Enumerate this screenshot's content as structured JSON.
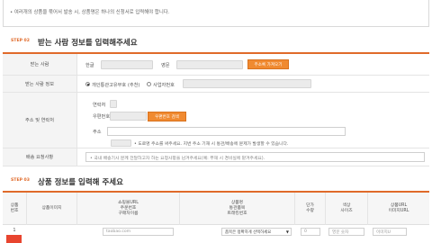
{
  "notice": {
    "text": "• 여러개의 상품을 묶어서 발송 시, 상품명은 하나의 신청서로 입력해야 합니다.",
    "highlight": ""
  },
  "step2": {
    "tag": "STEP 02",
    "title": "받는 사람 정보를 입력해주세요"
  },
  "recipient": {
    "name_label": "받는 사람",
    "korean_label": "한글",
    "english_label": "영문",
    "address_book_button": "주소록 가져오기",
    "info_label": "받는 사람 정보",
    "option_personal": "개인통관고유부호 (추천)",
    "option_business": "사업자번호",
    "address_label": "주소 및 연락처",
    "phone_label": "연락처",
    "postal_label": "우편번호",
    "postal_button": "우편번호 검색",
    "addr_label": "주소",
    "addr_hint": "• 도로명 주소를 써주세요. 지번 주소 기재 시 통관/배송에 문제가 발생할 수 있습니다.",
    "memo_label": "배송 요청사항",
    "memo_placeholder": "• 국내 배송기사 분께 전달하고자 하는 요청사항을 남겨주세요(예: 부재 시 경비실에 맡겨주세요)."
  },
  "step3": {
    "tag": "STEP 03",
    "title": "상품 정보를 입력해 주세요"
  },
  "product_table": {
    "headers": [
      "상품\n번호",
      "상품이미지",
      "쇼핑몰URL\n주문번호\n구매처이름",
      "상품명\n통관품목\n트래킹번호",
      "단가\n수량",
      "색상\n사이즈",
      "상품URL\n이미지URL"
    ],
    "row": {
      "number": "1",
      "url_placeholder": "taobao.com",
      "category_select": "품목은 정확하게 선택하세요",
      "price": "0",
      "color_placeholder": "영문 숫자",
      "img_placeholder": "이미지U"
    }
  }
}
